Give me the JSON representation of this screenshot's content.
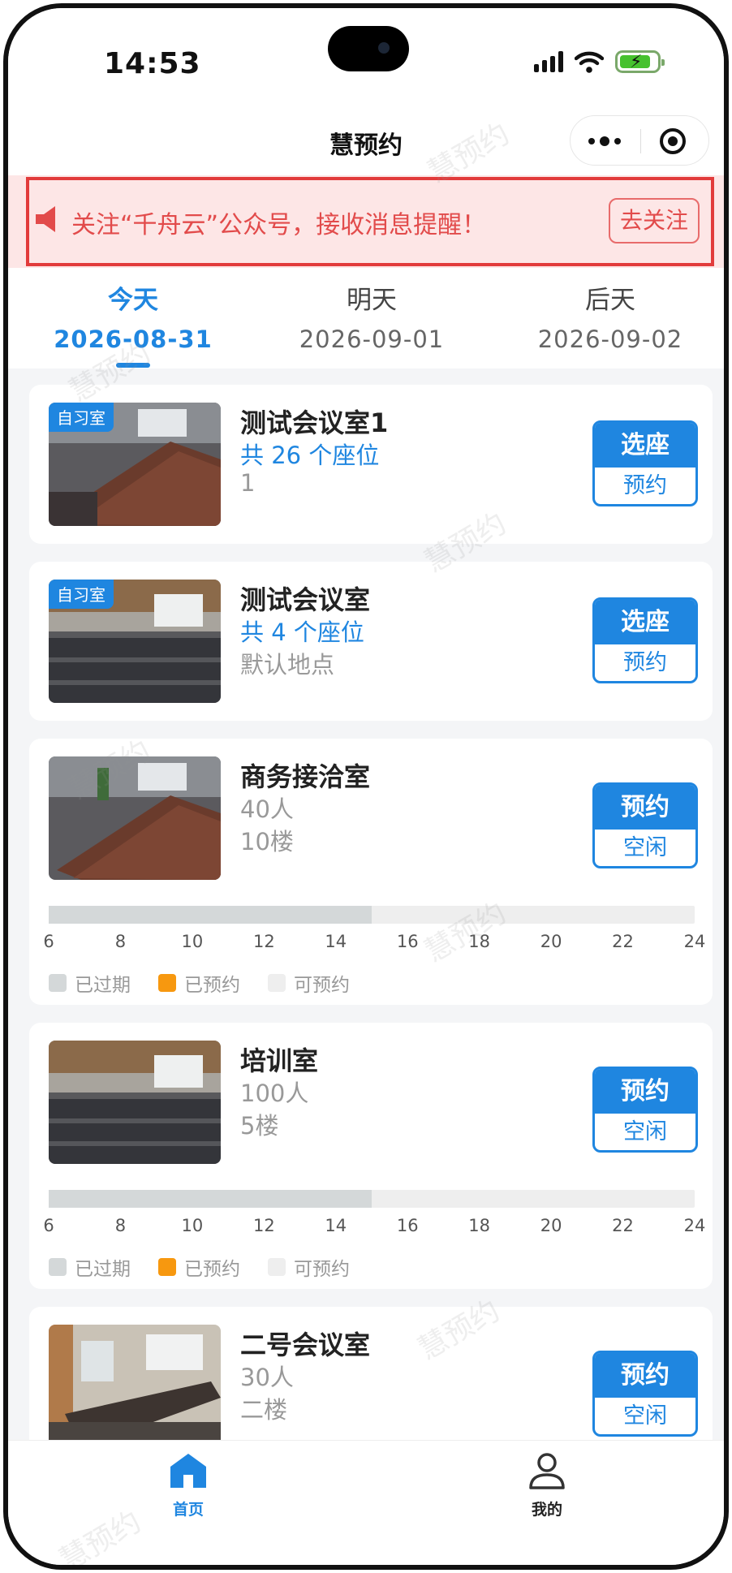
{
  "status_bar": {
    "time": "14:53"
  },
  "nav": {
    "title": "慧预约"
  },
  "notice": {
    "text": "关注“千舟云”公众号，接收消息提醒！",
    "button": "去关注"
  },
  "dates": [
    {
      "day": "今天",
      "date": "2026-08-31",
      "active": true
    },
    {
      "day": "明天",
      "date": "2026-09-01",
      "active": false
    },
    {
      "day": "后天",
      "date": "2026-09-02",
      "active": false
    }
  ],
  "rooms": [
    {
      "tag": "自习室",
      "name": "测试会议室1",
      "seats": "共 26 个座位",
      "location": "1",
      "btn_top": "选座",
      "btn_bottom": "预约"
    },
    {
      "tag": "自习室",
      "name": "测试会议室",
      "seats": "共 4 个座位",
      "location": "默认地点",
      "btn_top": "选座",
      "btn_bottom": "预约"
    },
    {
      "name": "商务接洽室",
      "capacity": "40人",
      "floor": "10楼",
      "btn_top": "预约",
      "btn_bottom": "空闲",
      "timeline_past_fraction": 0.5
    },
    {
      "name": "培训室",
      "capacity": "100人",
      "floor": "5楼",
      "btn_top": "预约",
      "btn_bottom": "空闲",
      "timeline_past_fraction": 0.5
    },
    {
      "name": "二号会议室",
      "capacity": "30人",
      "floor": "二楼",
      "btn_top": "预约",
      "btn_bottom": "空闲"
    }
  ],
  "timeline": {
    "hours": [
      "6",
      "8",
      "10",
      "12",
      "14",
      "16",
      "18",
      "20",
      "22",
      "24"
    ],
    "legend": [
      {
        "label": "已过期",
        "color": "#d4d8d9"
      },
      {
        "label": "已预约",
        "color": "#f7980f"
      },
      {
        "label": "可预约",
        "color": "#eeeeee"
      }
    ]
  },
  "tabbar": {
    "home": "首页",
    "mine": "我的"
  },
  "watermark": "慧预约",
  "colors": {
    "primary": "#1f86e0",
    "notice_bg": "#fde6e6",
    "notice_text": "#e24b4b"
  }
}
